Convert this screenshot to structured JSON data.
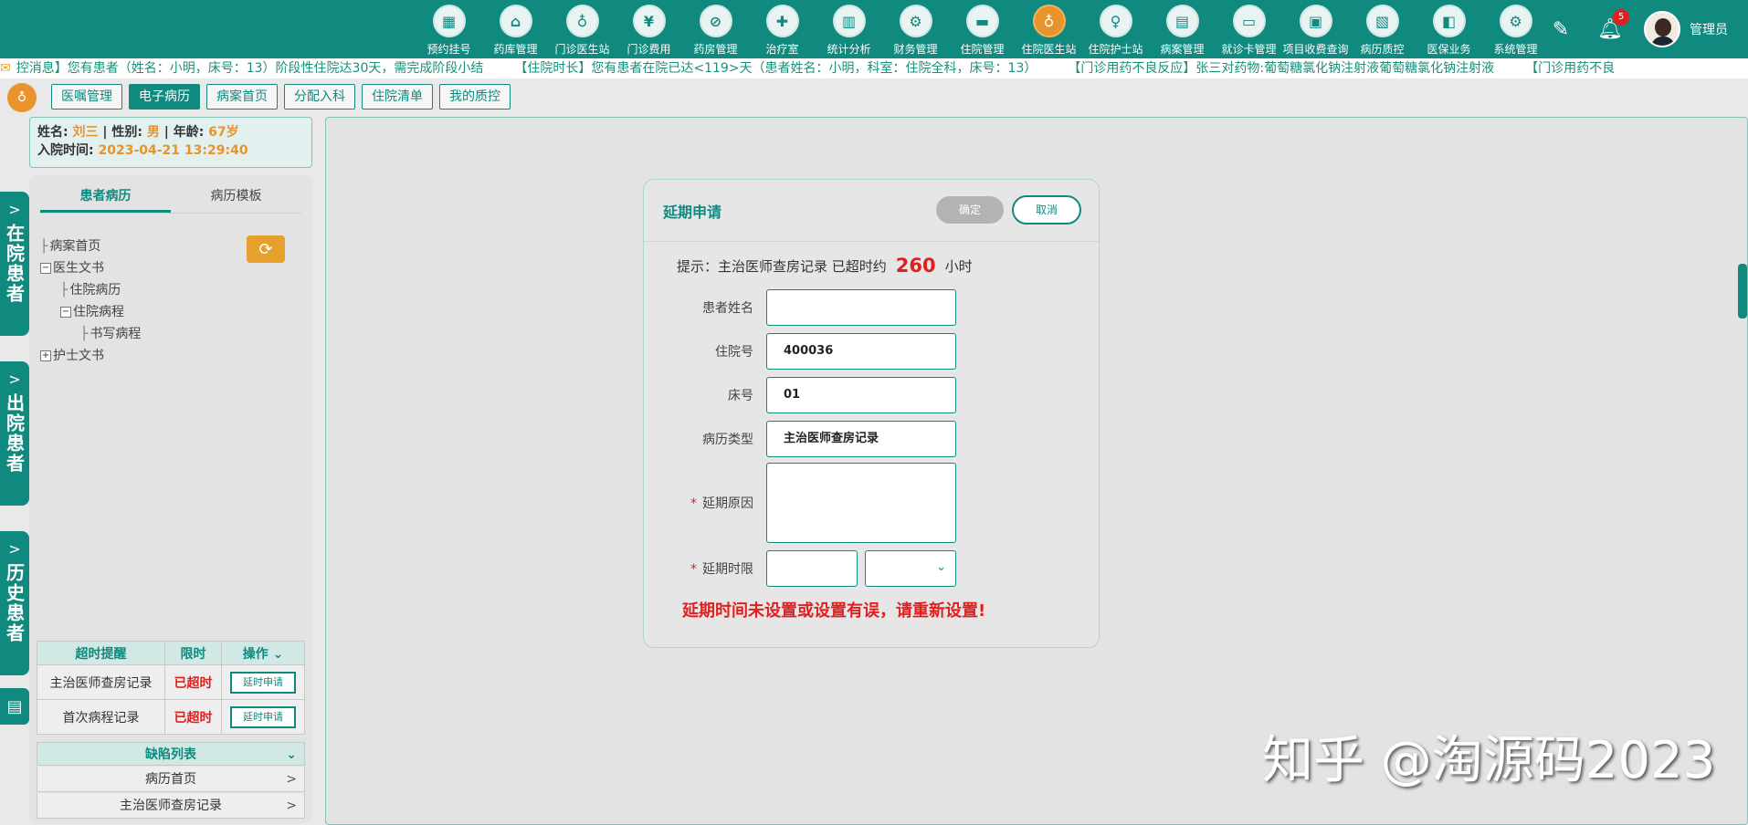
{
  "nav": {
    "items": [
      {
        "label": "预约挂号",
        "icon": "calendar-icon",
        "glyph": "▦"
      },
      {
        "label": "药库管理",
        "icon": "warehouse-icon",
        "glyph": "⌂"
      },
      {
        "label": "门诊医生站",
        "icon": "doctor-icon",
        "glyph": "♁"
      },
      {
        "label": "门诊费用",
        "icon": "yuan-icon",
        "glyph": "¥"
      },
      {
        "label": "药房管理",
        "icon": "pill-icon",
        "glyph": "⊘"
      },
      {
        "label": "治疗室",
        "icon": "nurse-icon",
        "glyph": "✚"
      },
      {
        "label": "统计分析",
        "icon": "chart-icon",
        "glyph": "▥"
      },
      {
        "label": "财务管理",
        "icon": "gear-money-icon",
        "glyph": "⚙"
      },
      {
        "label": "住院管理",
        "icon": "bed-icon",
        "glyph": "▬"
      },
      {
        "label": "住院医生站",
        "icon": "inpatient-doctor-icon",
        "glyph": "♁"
      },
      {
        "label": "住院护士站",
        "icon": "inpatient-nurse-icon",
        "glyph": "♀"
      },
      {
        "label": "病案管理",
        "icon": "record-icon",
        "glyph": "▤"
      },
      {
        "label": "就诊卡管理",
        "icon": "card-icon",
        "glyph": "▭"
      },
      {
        "label": "项目收费查询",
        "icon": "search-doc-icon",
        "glyph": "▣"
      },
      {
        "label": "病历质控",
        "icon": "quality-icon",
        "glyph": "▧"
      },
      {
        "label": "医保业务",
        "icon": "insurance-icon",
        "glyph": "◧"
      },
      {
        "label": "系统管理",
        "icon": "settings-icon",
        "glyph": "⚙"
      }
    ]
  },
  "header": {
    "notification_count": "5",
    "user_name": "管理员"
  },
  "ticker": {
    "messages": [
      "控消息】您有患者（姓名：小明，床号：13）阶段性住院达30天，需完成阶段小结",
      "【住院时长】您有患者在院已达<119>天（患者姓名：小明，科室：住院全科，床号：13）",
      "【门诊用药不良反应】张三对药物:葡萄糖氯化钠注射液葡萄糖氯化钠注射液",
      "【门诊用药不良"
    ]
  },
  "toolbar": {
    "tabs": [
      "医嘱管理",
      "电子病历",
      "病案首页",
      "分配入科",
      "住院清单",
      "我的质控"
    ],
    "active_index": 1
  },
  "side_tabs": [
    "在院患者",
    "出院患者",
    "历史患者"
  ],
  "patient": {
    "name_label": "姓名:",
    "name": "刘三",
    "gender_label": "| 性别:",
    "gender": "男",
    "age_label": "| 年龄:",
    "age": "67岁",
    "admit_label": "入院时间:",
    "admit_time": "2023-04-21 13:29:40"
  },
  "left_panel": {
    "tabs": [
      "患者病历",
      "病历模板"
    ],
    "tree": [
      {
        "label": "病案首页",
        "level": 0,
        "box": ""
      },
      {
        "label": "医生文书",
        "level": 0,
        "box": "−"
      },
      {
        "label": "住院病历",
        "level": 1,
        "box": ""
      },
      {
        "label": "住院病程",
        "level": 1,
        "box": "−"
      },
      {
        "label": "书写病程",
        "level": 2,
        "box": ""
      },
      {
        "label": "护士文书",
        "level": 0,
        "box": "+"
      }
    ]
  },
  "overtime_table": {
    "headers": [
      "超时提醒",
      "限时",
      "操作"
    ],
    "rows": [
      {
        "name": "主治医师查房记录",
        "status": "已超时",
        "action": "延时申请"
      },
      {
        "name": "首次病程记录",
        "status": "已超时",
        "action": "延时申请"
      }
    ]
  },
  "defects": {
    "title": "缺陷列表",
    "items": [
      "病历首页",
      "主治医师查房记录"
    ]
  },
  "modal": {
    "title": "延期申请",
    "ok_label": "确定",
    "cancel_label": "取消",
    "hint_prefix": "提示：主治医师查房记录 已超时约",
    "hint_hours": "260",
    "hint_suffix": "小时",
    "fields": {
      "patient_name_label": "患者姓名",
      "patient_name_value": "",
      "admission_no_label": "住院号",
      "admission_no_value": "400036",
      "bed_no_label": "床号",
      "bed_no_value": "01",
      "record_type_label": "病历类型",
      "record_type_value": "主治医师查房记录",
      "reason_label": "延期原因",
      "reason_value": "",
      "limit_label": "延期时限",
      "limit_value": "",
      "limit_unit": ""
    },
    "error": "延期时间未设置或设置有误，请重新设置!"
  },
  "watermark": "知乎 @淘源码2023",
  "colors": {
    "brand": "#10897f",
    "accent": "#e8932c",
    "error": "#e02020"
  }
}
